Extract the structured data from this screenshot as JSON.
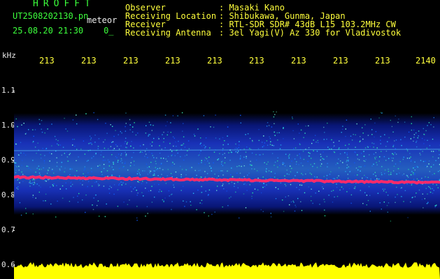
{
  "header": {
    "title": "HROFFT",
    "filename": "UT2508202130.pn",
    "mode": "meteor",
    "datetime": "25.08.20 21:30",
    "datetime_suffix": "0_"
  },
  "station": {
    "observer_label": "Observer",
    "observer_value": ": Masaki Kano",
    "location_label": "Receiving Location",
    "location_value": ": Shibukawa, Gunma, Japan",
    "receiver_label": "Receiver",
    "receiver_value": ": RTL-SDR SDR# 43dB L15 103.2MHz CW",
    "antenna_label": "Receiving Antenna",
    "antenna_value": ": 3el Yagi(V) Az 330 for Vladivostok"
  },
  "axes": {
    "y_unit": "kHz",
    "x_ticks": [
      "213",
      "213",
      "213",
      "213",
      "213",
      "213",
      "213",
      "213",
      "213",
      "2140"
    ],
    "y_ticks": [
      "1.1",
      "1.0",
      "0.9",
      "0.8",
      "0.7",
      "0.6"
    ]
  },
  "colors": {
    "background": "#000000",
    "noise_band": "#1a2fc8",
    "echo": "#ff2a6a",
    "envelope": "#ffff00"
  }
}
